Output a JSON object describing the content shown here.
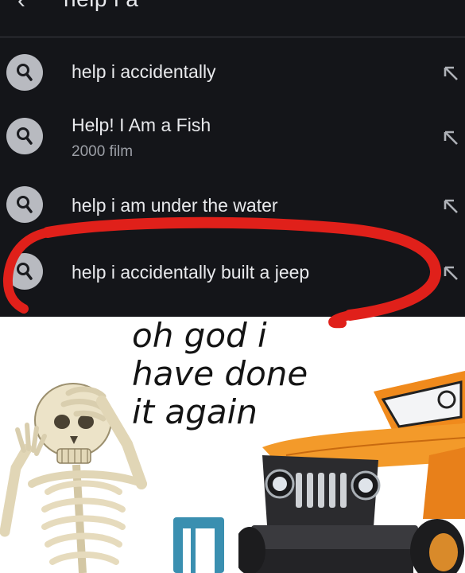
{
  "search": {
    "query": "help i a",
    "suggestions": [
      {
        "text": "help i accidentally",
        "sub": ""
      },
      {
        "text": "Help! I Am a Fish",
        "sub": "2000 film"
      },
      {
        "text": "help i am under the water",
        "sub": ""
      },
      {
        "text": "help i accidentally built a jeep",
        "sub": ""
      }
    ]
  },
  "meme": {
    "caption_lines": [
      "oh god i",
      "have done",
      "it again"
    ]
  },
  "icons": {
    "back": "back-arrow-icon",
    "search": "search-icon",
    "fill": "fill-query-arrow-icon"
  },
  "colors": {
    "panel_bg": "#141519",
    "scribble": "#e0201a",
    "jeep_orange": "#f08a1c"
  }
}
